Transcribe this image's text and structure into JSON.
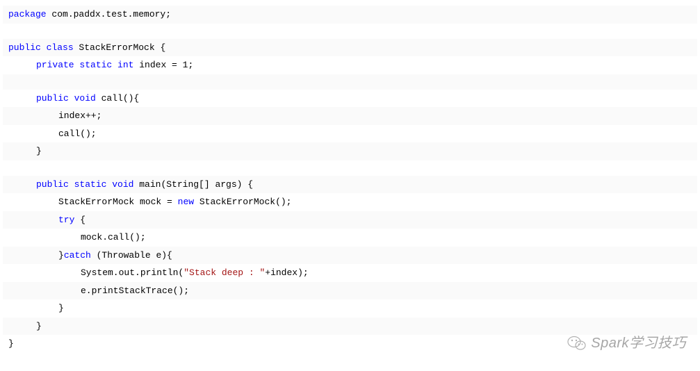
{
  "code": {
    "l1_kw1": "package",
    "l1_pkg": " com.paddx.test.memory;",
    "l3_kw1": "public",
    "l3_kw2": " class",
    "l3_cls": " StackErrorMock ",
    "l3_brace": "{",
    "l4_kw1": "private",
    "l4_kw2": " static",
    "l4_kw3": " int",
    "l4_rest": " index = 1;",
    "l6_kw1": "public",
    "l6_kw2": " void",
    "l6_rest": " call(){",
    "l7": "index++;",
    "l8": "call();",
    "l9": "}",
    "l11_kw1": "public",
    "l11_kw2": " static",
    "l11_kw3": " void",
    "l11_rest": " main(String[] args) {",
    "l12_a": "StackErrorMock mock = ",
    "l12_new": "new",
    "l12_b": " StackErrorMock();",
    "l13_kw": "try",
    "l13_rest": " {",
    "l14": "mock.call();",
    "l15_a": "}",
    "l15_kw": "catch",
    "l15_b": " (Throwable e){",
    "l16_a": "System.out.println(",
    "l16_str": "\"Stack deep : \"",
    "l16_b": "+index);",
    "l17": "e.printStackTrace();",
    "l18": "}",
    "l19": "}",
    "l20": "}"
  },
  "watermark": {
    "text": "Spark学习技巧"
  }
}
